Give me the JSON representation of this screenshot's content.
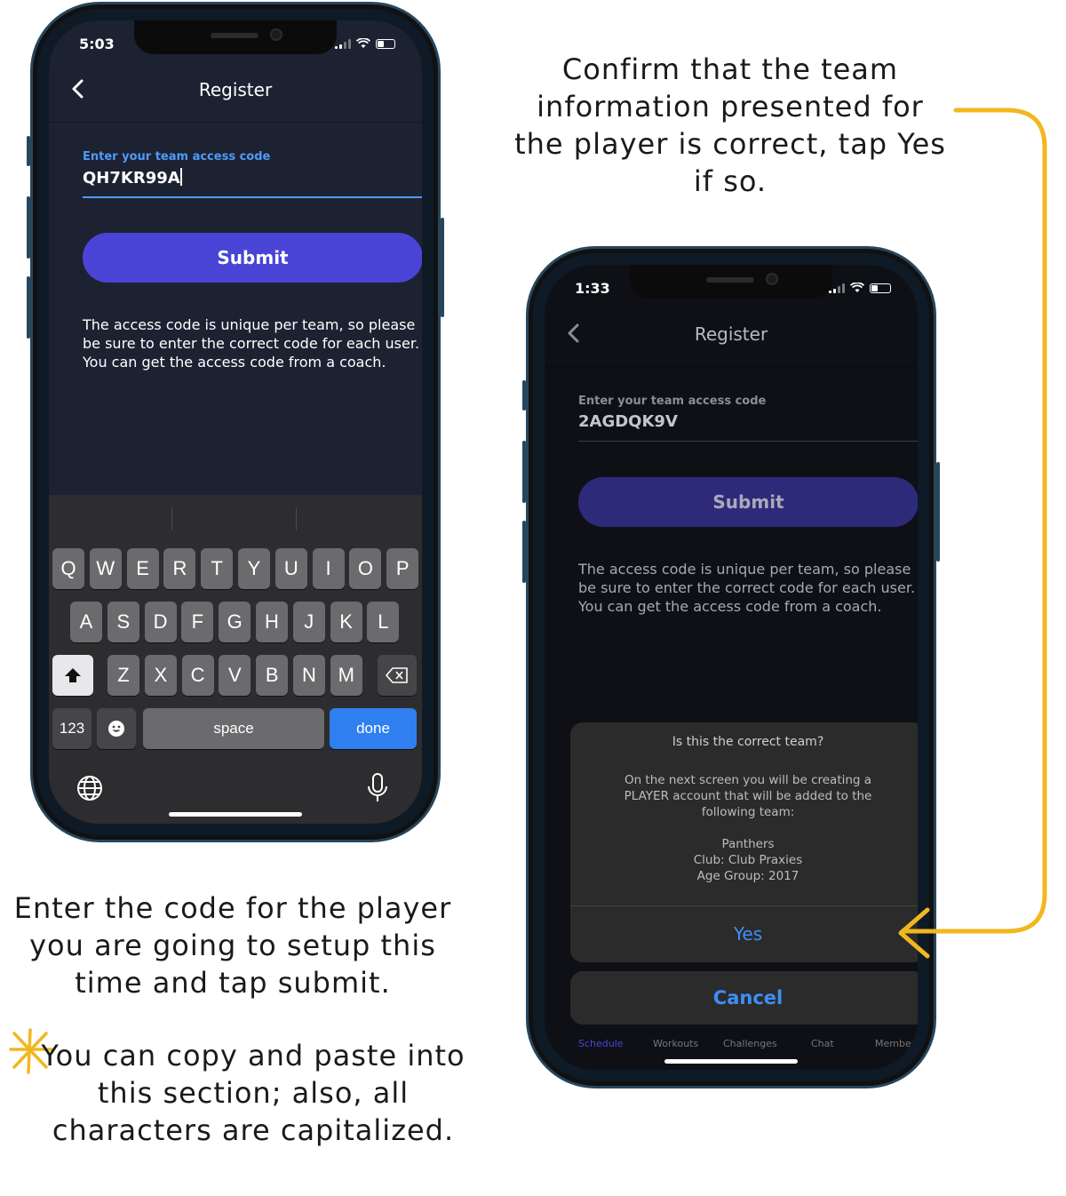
{
  "left_phone": {
    "status_time": "5:03",
    "nav_title": "Register",
    "field_label": "Enter your team access code",
    "field_value": "QH7KR99A",
    "submit_label": "Submit",
    "info_text": "The access code is unique per team, so please be sure to enter the correct code for each user. You can get the access code from a coach.",
    "keyboard": {
      "row1": [
        "Q",
        "W",
        "E",
        "R",
        "T",
        "Y",
        "U",
        "I",
        "O",
        "P"
      ],
      "row2": [
        "A",
        "S",
        "D",
        "F",
        "G",
        "H",
        "J",
        "K",
        "L"
      ],
      "row3": [
        "Z",
        "X",
        "C",
        "V",
        "B",
        "N",
        "M"
      ],
      "numbers_key": "123",
      "space_key": "space",
      "done_key": "done"
    }
  },
  "right_phone": {
    "status_time": "1:33",
    "nav_title": "Register",
    "field_label": "Enter your team access code",
    "field_value": "2AGDQK9V",
    "submit_label": "Submit",
    "info_text": "The access code is unique per team, so please be sure to enter the correct code for each user. You can get the access code from a coach.",
    "dialog": {
      "title": "Is this the correct team?",
      "message_line1": "On the next screen you will be creating a",
      "message_line2": "PLAYER account that will be added to the",
      "message_line3": "following team:",
      "team_name": "Panthers",
      "club": "Club: Club Praxies",
      "age_group": "Age Group: 2017",
      "yes_label": "Yes",
      "cancel_label": "Cancel"
    },
    "tabbar": [
      "Schedule",
      "Workouts",
      "Challenges",
      "Chat",
      "Members"
    ]
  },
  "captions": {
    "top_right": "Confirm that the team information presented for the player is correct, tap Yes if so.",
    "bottom_left": "Enter the code for the player you are going to setup this time and tap submit.",
    "tip": "You can copy and paste into this section; also, all characters are capitalized."
  },
  "colors": {
    "accent_arrow": "#f2b71f",
    "submit_active": "#4a44d6",
    "submit_dim": "#2e2a7a",
    "link_blue": "#3e8ef7",
    "screen_bg": "#1c2232"
  }
}
